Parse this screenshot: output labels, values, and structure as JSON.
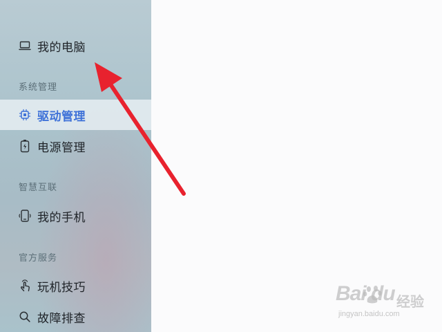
{
  "sidebar": {
    "my_computer": {
      "label": "我的电脑",
      "icon": "laptop-icon"
    },
    "sections": [
      {
        "header": "系统管理",
        "items": [
          {
            "label": "驱动管理",
            "icon": "chip-icon",
            "active": true
          },
          {
            "label": "电源管理",
            "icon": "battery-icon",
            "active": false
          }
        ]
      },
      {
        "header": "智慧互联",
        "items": [
          {
            "label": "我的手机",
            "icon": "phone-icon",
            "active": false
          }
        ]
      },
      {
        "header": "官方服务",
        "items": [
          {
            "label": "玩机技巧",
            "icon": "tap-hand-icon",
            "active": false
          },
          {
            "label": "故障排查",
            "icon": "search-icon",
            "active": false
          }
        ]
      }
    ]
  },
  "colors": {
    "accent": "#3f72d8",
    "annotation_arrow": "#e8222e"
  },
  "watermark": {
    "brand": "Bai  du",
    "suffix": "经验",
    "url": "jingyan.baidu.com"
  }
}
